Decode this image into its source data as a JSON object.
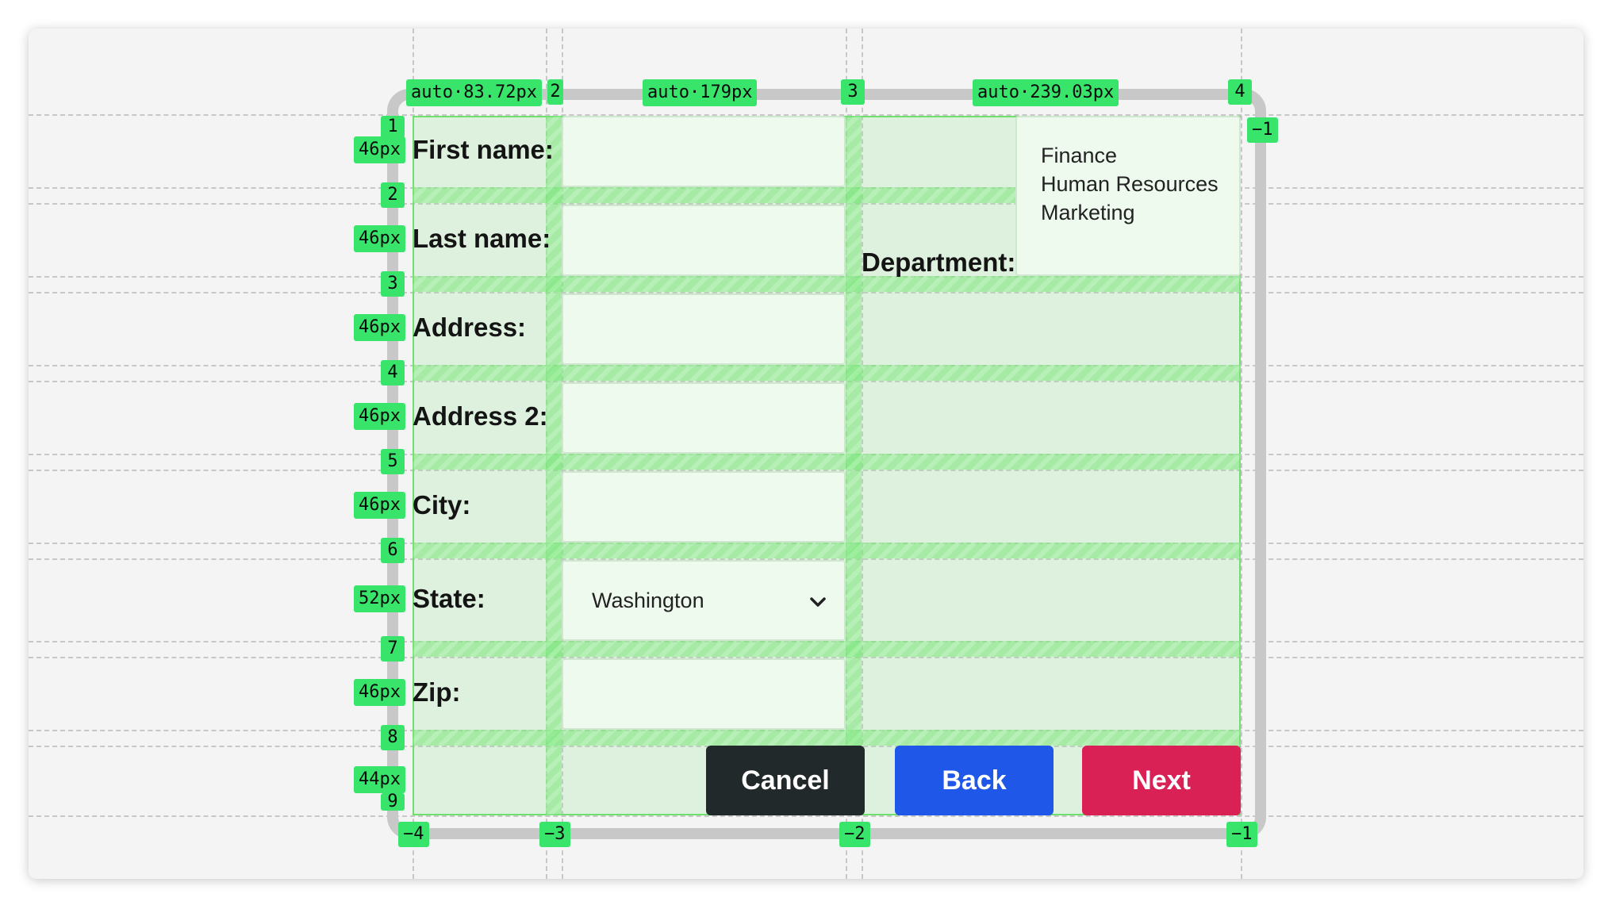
{
  "form": {
    "labels": {
      "first_name": "First name:",
      "last_name": "Last name:",
      "address": "Address:",
      "address2": "Address 2:",
      "city": "City:",
      "state": "State:",
      "zip": "Zip:",
      "department": "Department:"
    },
    "state_selected": "Washington",
    "department_options": [
      "Finance",
      "Human Resources",
      "Marketing"
    ],
    "buttons": {
      "cancel": "Cancel",
      "back": "Back",
      "next": "Next"
    }
  },
  "grid_overlay": {
    "column_sizes": [
      "auto·83.72px",
      "auto·179px",
      "auto·239.03px"
    ],
    "row_sizes": [
      "46px",
      "46px",
      "46px",
      "46px",
      "46px",
      "52px",
      "46px",
      "44px"
    ],
    "column_line_numbers": [
      "2",
      "3",
      "4"
    ],
    "row_line_numbers": [
      "1",
      "2",
      "3",
      "4",
      "5",
      "6",
      "7",
      "8",
      "9"
    ],
    "negative_column_numbers": [
      "−4",
      "−3",
      "−2",
      "−1"
    ],
    "negative_row_number": "−1"
  },
  "colors": {
    "cancel": "#22292a",
    "back": "#1f57e8",
    "next": "#d92155",
    "overlay": "#39e46a"
  }
}
